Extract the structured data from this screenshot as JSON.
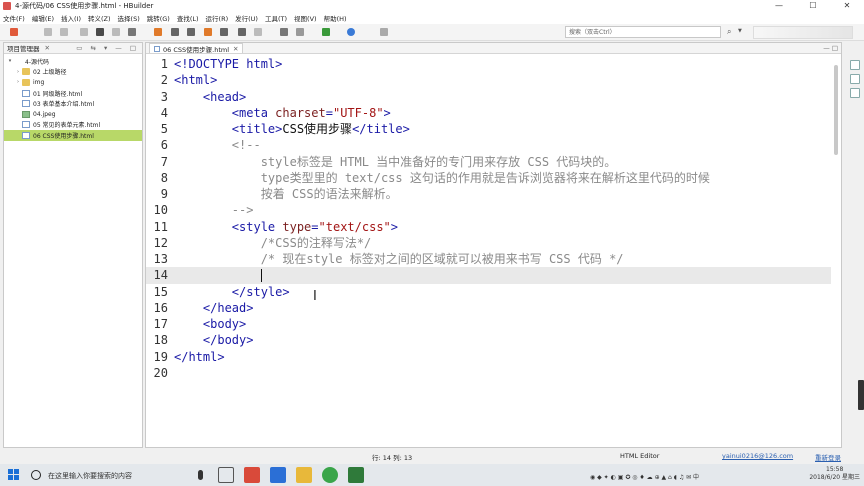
{
  "window": {
    "title": "4-源代码/06 CSS使用步骤.html - HBuilder"
  },
  "window_controls": {
    "minimize": "—",
    "maximize": "☐",
    "close": "✕"
  },
  "menu": [
    "文件(F)",
    "编辑(E)",
    "插入(I)",
    "转义(Z)",
    "选择(S)",
    "跳转(G)",
    "查找(L)",
    "运行(R)",
    "发行(U)",
    "工具(T)",
    "视图(V)",
    "帮助(H)"
  ],
  "search": {
    "placeholder": "搜索（双击Ctrl）"
  },
  "project_panel": {
    "tab_label": "项目管理器",
    "close": "✕",
    "items": [
      {
        "label": "4-源代码",
        "type": "project",
        "arrow": "▾"
      },
      {
        "label": "02 上级路径",
        "type": "folder",
        "arrow": "›"
      },
      {
        "label": "img",
        "type": "folder",
        "arrow": "›"
      },
      {
        "label": "01 同级路径.html",
        "type": "file",
        "arrow": ""
      },
      {
        "label": "03 表单基本介绍.html",
        "type": "file",
        "arrow": ""
      },
      {
        "label": "04.jpeg",
        "type": "img",
        "arrow": ""
      },
      {
        "label": "05 常见的表单元素.html",
        "type": "file",
        "arrow": ""
      },
      {
        "label": "06 CSS使用步骤.html",
        "type": "file",
        "arrow": ""
      }
    ],
    "selected_index": 7
  },
  "editor": {
    "tab_label": "06 CSS使用步骤.html",
    "tab_close": "✕",
    "current_line": 14,
    "lines": [
      {
        "n": "1",
        "parts": [
          [
            "tag",
            "<!DOCTYPE html>"
          ]
        ]
      },
      {
        "n": "2",
        "parts": [
          [
            "tag",
            "<html>"
          ]
        ]
      },
      {
        "n": "3",
        "parts": [
          [
            "txt",
            "    "
          ],
          [
            "tag",
            "<head>"
          ]
        ]
      },
      {
        "n": "4",
        "parts": [
          [
            "txt",
            "        "
          ],
          [
            "tag",
            "<meta "
          ],
          [
            "attr",
            "charset"
          ],
          [
            "tag",
            "="
          ],
          [
            "val",
            "\"UTF-8\""
          ],
          [
            "tag",
            ">"
          ]
        ]
      },
      {
        "n": "5",
        "parts": [
          [
            "txt",
            "        "
          ],
          [
            "tag",
            "<title>"
          ],
          [
            "txt",
            "CSS使用步骤"
          ],
          [
            "tag",
            "</title>"
          ]
        ]
      },
      {
        "n": "6",
        "parts": [
          [
            "txt",
            "        "
          ],
          [
            "cmt",
            "<!--"
          ]
        ]
      },
      {
        "n": "7",
        "parts": [
          [
            "cmt",
            "            style标签是 HTML 当中准备好的专门用来存放 CSS 代码块的。"
          ]
        ]
      },
      {
        "n": "8",
        "parts": [
          [
            "cmt",
            "            type类型里的 text/css 这句话的作用就是告诉浏览器将来在解析这里代码的时候"
          ]
        ]
      },
      {
        "n": "9",
        "parts": [
          [
            "cmt",
            "            按着 CSS的语法来解析。"
          ]
        ]
      },
      {
        "n": "10",
        "parts": [
          [
            "cmt",
            "        -->"
          ]
        ]
      },
      {
        "n": "11",
        "parts": [
          [
            "txt",
            "        "
          ],
          [
            "tag",
            "<style "
          ],
          [
            "attr",
            "type"
          ],
          [
            "tag",
            "="
          ],
          [
            "val",
            "\"text/css\""
          ],
          [
            "tag",
            ">"
          ]
        ]
      },
      {
        "n": "12",
        "parts": [
          [
            "cmt",
            "            /*CSS的注释写法*/"
          ]
        ]
      },
      {
        "n": "13",
        "parts": [
          [
            "cmt",
            "            /* 现在style 标签对之间的区域就可以被用来书写 CSS 代码 */"
          ]
        ]
      },
      {
        "n": "14",
        "parts": [
          [
            "txt",
            "            "
          ]
        ]
      },
      {
        "n": "15",
        "parts": [
          [
            "txt",
            "        "
          ],
          [
            "tag",
            "</style>"
          ]
        ]
      },
      {
        "n": "16",
        "parts": [
          [
            "txt",
            "    "
          ],
          [
            "tag",
            "</head>"
          ]
        ]
      },
      {
        "n": "17",
        "parts": [
          [
            "txt",
            "    "
          ],
          [
            "tag",
            "<body>"
          ]
        ]
      },
      {
        "n": "18",
        "parts": [
          [
            "txt",
            "    "
          ],
          [
            "tag",
            "</body>"
          ]
        ]
      },
      {
        "n": "19",
        "parts": [
          [
            "tag",
            "</html>"
          ]
        ]
      },
      {
        "n": "20",
        "parts": []
      }
    ]
  },
  "status": {
    "position": "行: 14 列: 13",
    "mode": "HTML Editor",
    "user": "yainui0216@126.com",
    "action": "重新登录"
  },
  "taskbar": {
    "search_placeholder": "在这里输入你要搜索的内容",
    "time": "15:58",
    "date": "2018/6/20 星期三"
  },
  "colors": {
    "tag": "#1a1aa6",
    "attribute": "#7a1f1f",
    "string": "#a31515",
    "comment": "#8a8a8a",
    "selection": "#b8d868"
  }
}
